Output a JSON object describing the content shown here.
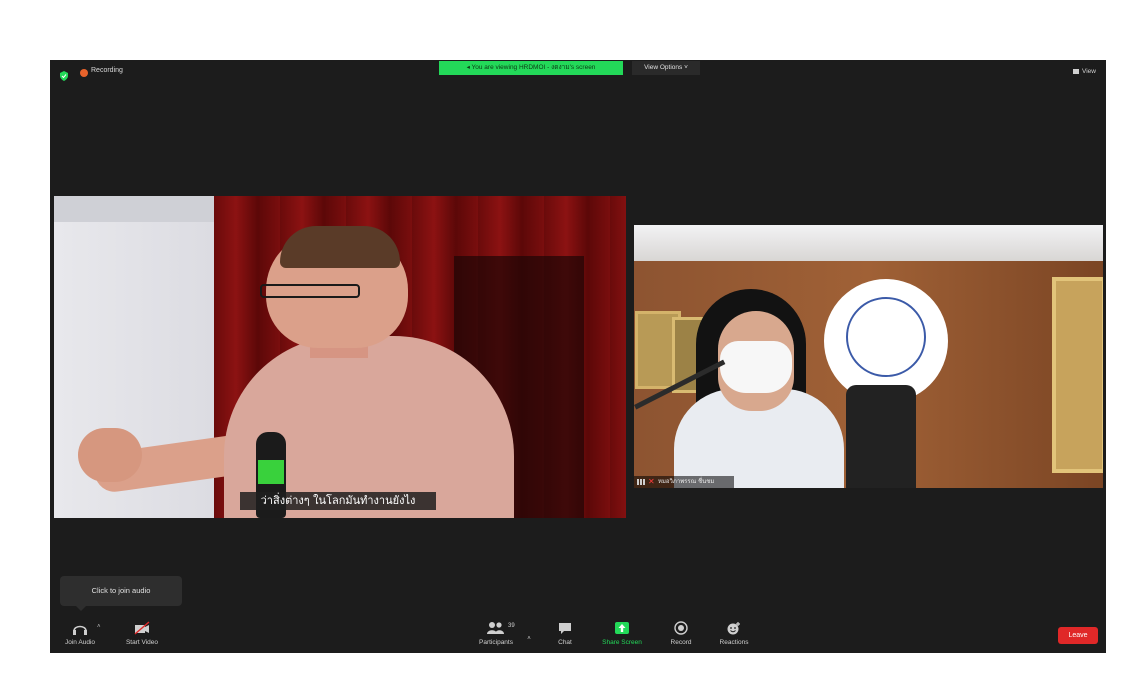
{
  "top_bar": {
    "recording_label": "Recording",
    "viewing_banner": "You are viewing HRDMOI - งดงาม's screen",
    "view_options_label": "View Options",
    "view_label": "View"
  },
  "shared_video": {
    "subtitle": "ว่าสิ่งต่างๆ ในโลกมันทำงานยังไง"
  },
  "participant_video": {
    "name": "หมอวิภาพรรณ ชื่นชม"
  },
  "tooltip": {
    "text": "Click to join audio"
  },
  "toolbar": {
    "join_audio_label": "Join Audio",
    "start_video_label": "Start Video",
    "participants_label": "Participants",
    "participants_count": "39",
    "chat_label": "Chat",
    "share_screen_label": "Share Screen",
    "record_label": "Record",
    "reactions_label": "Reactions",
    "leave_label": "Leave"
  },
  "colors": {
    "window_bg": "#1c1c1c",
    "banner_green": "#23d959",
    "leave_red": "#e02828",
    "recording_orange": "#e8632b"
  },
  "icons": {
    "security": "shield-icon",
    "recording": "record-dot-icon",
    "view": "grid-view-icon",
    "join_audio": "headphones-icon",
    "start_video": "video-off-icon",
    "participants": "people-icon",
    "chat": "chat-bubble-icon",
    "share_screen": "share-arrow-icon",
    "record": "record-icon",
    "reactions": "smiley-plus-icon"
  }
}
